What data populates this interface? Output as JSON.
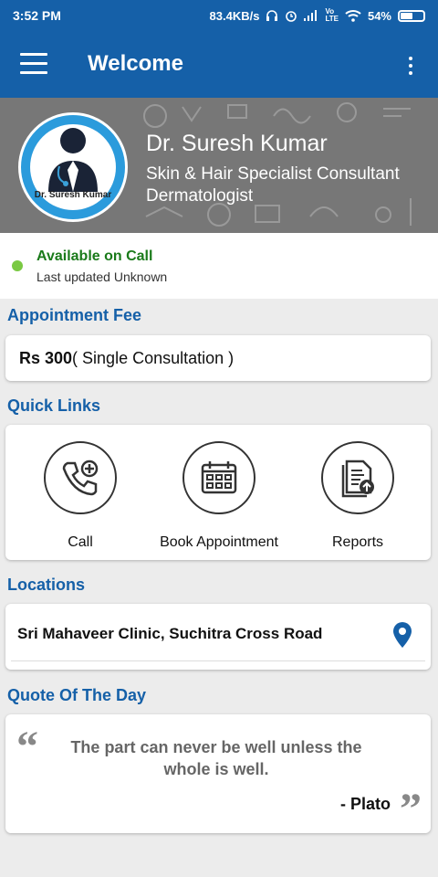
{
  "status_bar": {
    "time": "3:52 PM",
    "speed": "83.4KB/s",
    "battery": "54%"
  },
  "app_bar": {
    "title": "Welcome"
  },
  "doctor": {
    "name": "Dr. Suresh Kumar",
    "avatar_label": "Dr. Suresh Kumar",
    "specialty_line1": "Skin & Hair Specialist Consultant",
    "specialty_line2": "Dermatologist"
  },
  "availability": {
    "status": "Available on Call",
    "last_updated": "Last updated Unknown",
    "status_color": "#7ac943"
  },
  "appointment_fee": {
    "section_title": "Appointment Fee",
    "amount": "Rs 300",
    "description": "( Single Consultation )"
  },
  "quick_links": {
    "section_title": "Quick Links",
    "items": [
      {
        "label": "Call",
        "icon": "phone-plus-icon"
      },
      {
        "label": "Book Appointment",
        "icon": "calendar-icon"
      },
      {
        "label": "Reports",
        "icon": "report-upload-icon"
      }
    ]
  },
  "locations": {
    "section_title": "Locations",
    "items": [
      {
        "name": "Sri Mahaveer Clinic, Suchitra Cross Road",
        "icon": "location-pin-icon"
      }
    ]
  },
  "quote": {
    "section_title": "Quote Of The Day",
    "text": "The part can never be well unless the whole is well.",
    "author": "- Plato"
  },
  "colors": {
    "primary": "#1560a8",
    "available_text": "#1a7a1a",
    "background": "#ececec"
  }
}
